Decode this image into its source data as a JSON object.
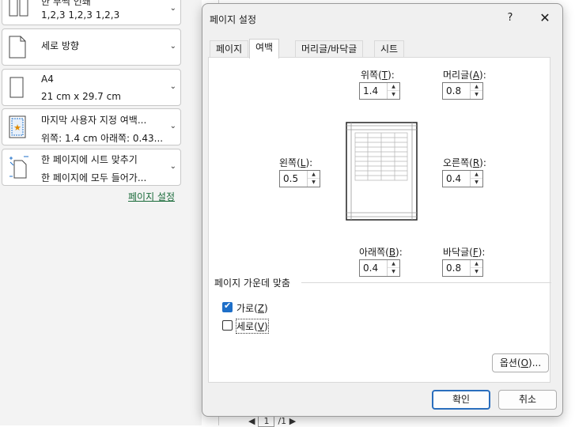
{
  "print_panel": {
    "cards": [
      {
        "line1": "한 부씩 인쇄",
        "line2": "1,2,3     1,2,3     1,2,3",
        "icon": "collate-icon"
      },
      {
        "line1": "세로 방향",
        "line2": "",
        "icon": "portrait-orientation-icon"
      },
      {
        "line1": "A4",
        "line2": "21 cm x 29.7 cm",
        "icon": "paper-size-icon"
      },
      {
        "line1": "마지막 사용자 지정 여백...",
        "line2": "위쪽: 1.4 cm 아래쪽: 0.43...",
        "icon": "custom-margins-icon"
      },
      {
        "line1": "한 페이지에 시트 맞추기",
        "line2": "한 페이지에 모두 들어가...",
        "icon": "fit-sheet-icon"
      }
    ],
    "page_setup_link": "페이지 설정"
  },
  "pager": {
    "current": "1",
    "total": "/1"
  },
  "dialog": {
    "title": "페이지 설정",
    "help": "?",
    "close": "✕",
    "tabs": [
      {
        "label": "페이지",
        "active": false
      },
      {
        "label": "여백",
        "active": true
      },
      {
        "label": "머리글/바닥글",
        "active": false
      },
      {
        "label": "시트",
        "active": false
      }
    ],
    "margins": {
      "top": {
        "label": "위쪽",
        "key": "T",
        "value": "1.4"
      },
      "header": {
        "label": "머리글",
        "key": "A",
        "value": "0.8"
      },
      "left": {
        "label": "왼쪽",
        "key": "L",
        "value": "0.5"
      },
      "right": {
        "label": "오른쪽",
        "key": "R",
        "value": "0.4"
      },
      "bottom": {
        "label": "아래쪽",
        "key": "B",
        "value": "0.4"
      },
      "footer": {
        "label": "바닥글",
        "key": "F",
        "value": "0.8"
      }
    },
    "center_on_page": {
      "heading": "페이지 가운데 맞춤",
      "horizontal": {
        "label": "가로",
        "key": "Z",
        "checked": true
      },
      "vertical": {
        "label": "세로",
        "key": "V",
        "checked": false
      }
    },
    "options_button": {
      "label": "옵션",
      "key": "O",
      "suffix": "..."
    },
    "ok_button": "확인",
    "cancel_button": "취소"
  },
  "colors": {
    "accent": "#1e6fc8",
    "link": "#1a6b3a"
  }
}
